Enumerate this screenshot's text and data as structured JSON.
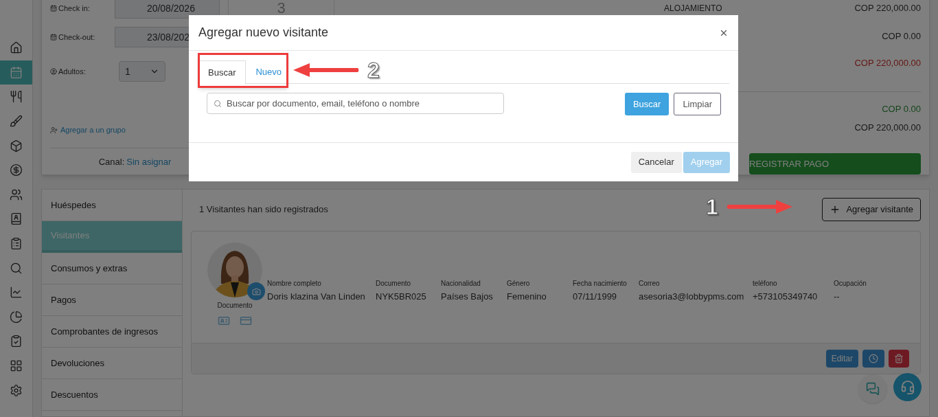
{
  "sidebar": {
    "items": [
      {
        "kind": "home",
        "selected": false
      },
      {
        "kind": "calendar",
        "selected": true
      },
      {
        "kind": "restaurant",
        "selected": false
      },
      {
        "kind": "cleaning",
        "selected": false
      },
      {
        "kind": "inventory",
        "selected": false
      },
      {
        "kind": "payments",
        "selected": false
      },
      {
        "kind": "guests",
        "selected": false
      },
      {
        "kind": "contacts",
        "selected": false
      },
      {
        "kind": "reports",
        "selected": false
      },
      {
        "kind": "search",
        "selected": false
      },
      {
        "kind": "statistics",
        "selected": false
      },
      {
        "kind": "charts",
        "selected": false
      },
      {
        "kind": "tasks",
        "selected": false
      },
      {
        "kind": "apps",
        "selected": false
      },
      {
        "kind": "settings",
        "selected": false
      }
    ]
  },
  "reservation": {
    "fields": [
      {
        "label": "Check in:",
        "value": "20/08/2026",
        "kind": "date"
      },
      {
        "label": "Check-out:",
        "value": "23/08/202",
        "kind": "date"
      },
      {
        "label": "Adultos:",
        "value": "1",
        "kind": "select"
      }
    ],
    "nights": "3",
    "group_link": "Agregar a un grupo",
    "channel_label": "Canal:",
    "channel_value": "Sin asignar"
  },
  "summary": {
    "heading": "ALOJAMIENTO",
    "amounts": [
      {
        "value": "COP 220,000.00",
        "kind": "normal"
      },
      {
        "value": "COP 0.00",
        "kind": "normal"
      },
      {
        "value": "COP 220,000.00",
        "kind": "due"
      },
      {
        "value": "COP 0.00",
        "kind": "paid"
      },
      {
        "value": "COP 220,000.00",
        "kind": "normal"
      }
    ],
    "pay_button": "REGISTRAR PAGO"
  },
  "sections": [
    {
      "label": "Huéspedes",
      "selected": false
    },
    {
      "label": "Visitantes",
      "selected": true
    },
    {
      "label": "Consumos y extras",
      "selected": false
    },
    {
      "label": "Pagos",
      "selected": false
    },
    {
      "label": "Comprobantes de ingresos",
      "selected": false
    },
    {
      "label": "Devoluciones",
      "selected": false
    },
    {
      "label": "Descuentos",
      "selected": false
    }
  ],
  "visitors": {
    "count_text": "1 Visitantes han sido registrados",
    "add_button": "Agregar visitante",
    "cards": [
      {
        "photo_caption": "Documento",
        "fields": [
          {
            "label": "Nombre completo",
            "value": "Doris klazina Van Linden"
          },
          {
            "label": "Documento",
            "value": "NYK5BR025"
          },
          {
            "label": "Nacionalidad",
            "value": "Países Bajos"
          },
          {
            "label": "Género",
            "value": "Femenino"
          },
          {
            "label": "Fecha nacimiento",
            "value": "07/11/1999"
          },
          {
            "label": "Correo",
            "value": "asesoria3@lobbypms.com"
          },
          {
            "label": "teléfono",
            "value": "+573105349740"
          },
          {
            "label": "Ocupación",
            "value": "--"
          }
        ],
        "buttons": [
          {
            "kind": "edit",
            "label": "Editar"
          },
          {
            "kind": "history"
          },
          {
            "kind": "delete"
          }
        ]
      }
    ]
  },
  "modal": {
    "title": "Agregar nuevo visitante",
    "tabs": [
      {
        "label": "Buscar",
        "selected": true
      },
      {
        "label": "Nuevo",
        "selected": false
      }
    ],
    "search": {
      "placeholder": "Buscar por documento, email, teléfono o nombre"
    },
    "buttons": [
      {
        "label": "Buscar",
        "kind": "primary",
        "disabled": false
      },
      {
        "label": "Limpiar",
        "kind": "outline",
        "disabled": false
      }
    ],
    "footer_buttons": [
      {
        "label": "Cancelar",
        "kind": "secondary",
        "disabled": false
      },
      {
        "label": "Agregar",
        "kind": "primary",
        "disabled": true
      }
    ]
  },
  "annotations": [
    {
      "number": "1",
      "highlight": false
    },
    {
      "number": "2",
      "highlight": true
    }
  ]
}
